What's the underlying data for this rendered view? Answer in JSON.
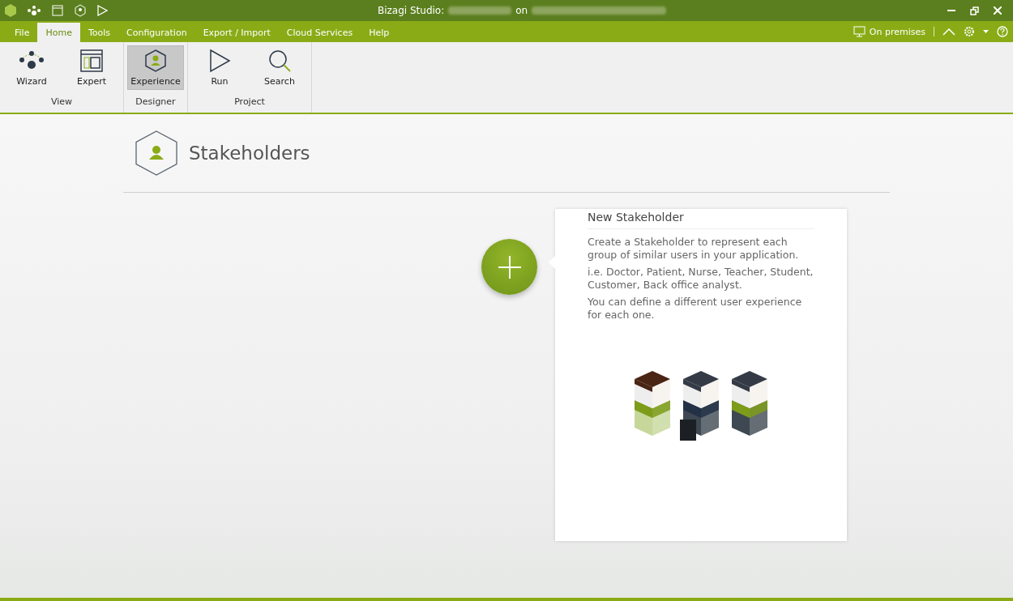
{
  "window": {
    "app_title": "Bizagi Studio:",
    "connector": "on"
  },
  "menu": {
    "tabs": [
      {
        "label": "File",
        "selected": false
      },
      {
        "label": "Home",
        "selected": true
      },
      {
        "label": "Tools",
        "selected": false
      },
      {
        "label": "Configuration",
        "selected": false
      },
      {
        "label": "Export / Import",
        "selected": false
      },
      {
        "label": "Cloud Services",
        "selected": false
      },
      {
        "label": "Help",
        "selected": false
      }
    ],
    "environment": "On premises"
  },
  "ribbon": {
    "groups": [
      {
        "label": "View",
        "buttons": [
          {
            "label": "Wizard",
            "kind": "wizard",
            "selected": false
          },
          {
            "label": "Expert",
            "kind": "expert",
            "selected": false
          }
        ]
      },
      {
        "label": "Designer",
        "buttons": [
          {
            "label": "Experience",
            "kind": "experience",
            "selected": true
          }
        ]
      },
      {
        "label": "Project",
        "buttons": [
          {
            "label": "Run",
            "kind": "run",
            "selected": false
          },
          {
            "label": "Search",
            "kind": "search",
            "selected": false
          }
        ]
      }
    ]
  },
  "page": {
    "title": "Stakeholders"
  },
  "card": {
    "title": "New Stakeholder",
    "paragraphs": [
      "Create a Stakeholder to represent each group of similar users in your application.",
      "i.e. Doctor, Patient, Nurse, Teacher, Student, Customer, Back office analyst.",
      "You can define a different user experience for each one."
    ]
  }
}
